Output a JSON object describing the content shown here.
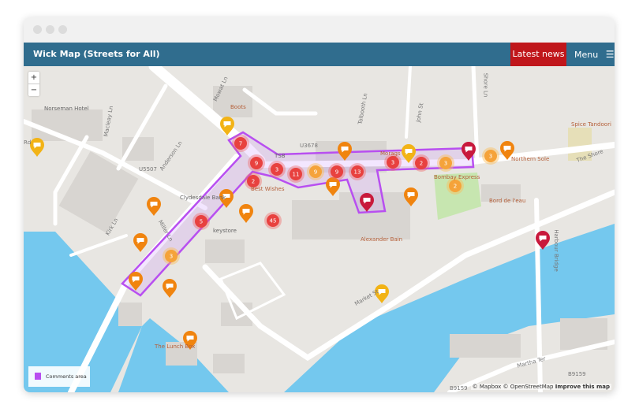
{
  "window": {
    "controls": [
      "close",
      "minimize",
      "maximize"
    ]
  },
  "header": {
    "title": "Wick Map (Streets for All)",
    "latest_news": "Latest news",
    "menu": "Menu",
    "menu_icon": "hamburger-icon",
    "accent": "#306d8e",
    "news_color": "#c0161b"
  },
  "map": {
    "zoom_in": "+",
    "zoom_out": "−",
    "labels": [
      "Norseman Hotel",
      "Boots",
      "Macleay Ln",
      "Mowat Ln",
      "Anderson Ln",
      "Tolbooth Ln",
      "Kirk Ln",
      "Miller Ln",
      "U5507",
      "U3678",
      "TSB",
      "Best Wishes",
      "Clydesdale Bank",
      "keystore",
      "Market St",
      "Alexander Bain",
      "Morags",
      "John St",
      "Shore Ln",
      "Bombay Express",
      "Bord de l'eau",
      "Northern Sole",
      "Spice Tandoori",
      "The Shore",
      "Harbour Bridge",
      "The Lunch Box",
      "Martha Ter",
      "B9159",
      "B9159",
      "Rd"
    ],
    "clusters": [
      {
        "count": "7",
        "color": "red"
      },
      {
        "count": "9",
        "color": "red"
      },
      {
        "count": "3",
        "color": "red"
      },
      {
        "count": "11",
        "color": "red"
      },
      {
        "count": "9",
        "color": "orange"
      },
      {
        "count": "9",
        "color": "red"
      },
      {
        "count": "13",
        "color": "red"
      },
      {
        "count": "3",
        "color": "red"
      },
      {
        "count": "2",
        "color": "red"
      },
      {
        "count": "3",
        "color": "orange"
      },
      {
        "count": "3",
        "color": "orange"
      },
      {
        "count": "2",
        "color": "orange"
      },
      {
        "count": "2",
        "color": "red"
      },
      {
        "count": "5",
        "color": "red"
      },
      {
        "count": "45",
        "color": "red"
      },
      {
        "count": "3",
        "color": "orange"
      }
    ],
    "pin_colors": {
      "comment_orange": "#f0840f",
      "comment_yellow": "#f2b316",
      "red": "#c8193c"
    },
    "water_color": "#74c8ee",
    "area_color": "#b84ff0"
  },
  "legend": {
    "label": "Comments area"
  },
  "attribution": {
    "mapbox": "© Mapbox",
    "osm": "© OpenStreetMap",
    "improve": "Improve this map"
  }
}
